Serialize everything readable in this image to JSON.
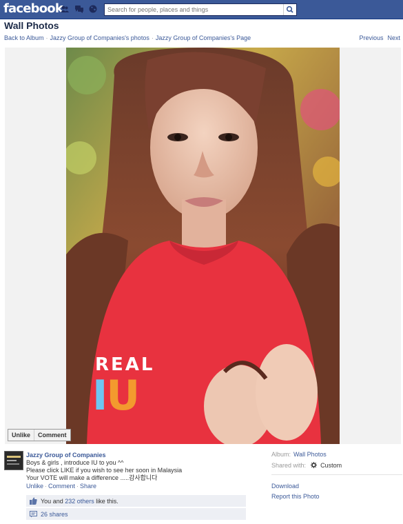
{
  "topbar": {
    "logo": "facebook",
    "search_placeholder": "Search for people, places and things"
  },
  "header": {
    "title": "Wall Photos",
    "breadcrumbs": [
      "Back to Album",
      "Jazzy Group of Companies's photos",
      "Jazzy Group of Companies's Page"
    ],
    "previous": "Previous",
    "next": "Next"
  },
  "photo": {
    "overlay_line1": "REAL",
    "overlay_i": "I",
    "overlay_u": "U",
    "actions": [
      "Unlike",
      "Comment"
    ]
  },
  "post": {
    "author": "Jazzy Group of Companies",
    "lines": [
      "Boys & girls , introduce IU to you ^^",
      "Please click LIKE if you wish to see her soon in Malaysia",
      "Your VOTE will make a difference .....감사합니다"
    ],
    "actions": [
      "Unlike",
      "Comment",
      "Share"
    ],
    "likes_prefix": "You and ",
    "likes_link": "232 others",
    "likes_suffix": " like this.",
    "shares": "26 shares"
  },
  "meta": {
    "album_label": "Album:",
    "album_value": "Wall Photos",
    "shared_label": "Shared with:",
    "shared_value": "Custom",
    "download": "Download",
    "report": "Report this Photo"
  },
  "colors": {
    "brand": "#3b5998",
    "link": "#3b5998",
    "sweater": "#e8323f",
    "iu_i": "#6ec6f2",
    "iu_u": "#f39a2e"
  }
}
